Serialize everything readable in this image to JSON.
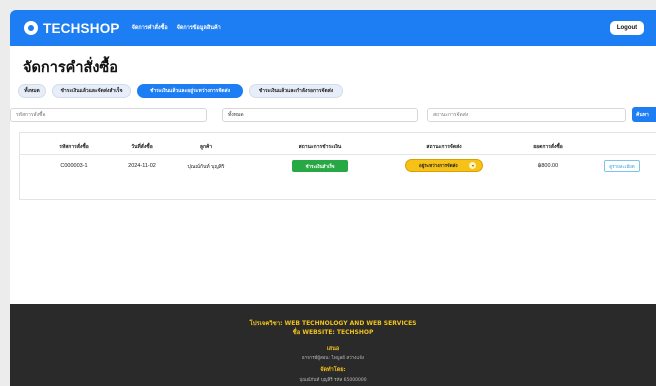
{
  "navbar": {
    "brand": "TECHSHOP",
    "links": [
      "จัดการคำสั่งซื้อ",
      "จัดการข้อมูลสินค้า"
    ],
    "logout_label": "Logout"
  },
  "main": {
    "title": "จัดการคำสั่งซื้อ",
    "filter_tabs": [
      {
        "label": "ทั้งหมด",
        "active": false
      },
      {
        "label": "ชำระเงินแล้วและจัดส่งสำเร็จ",
        "active": false
      },
      {
        "label": "ชำระเงินแล้วและอยู่ระหว่างการจัดส่ง",
        "active": true
      },
      {
        "label": "ชำระเงินแล้วและกำลังรอการจัดส่ง",
        "active": false
      }
    ],
    "search": {
      "order_id_placeholder": "รหัสการสั่งซื้อ",
      "payment_filter_value": "ทั้งหมด",
      "shipping_filter_placeholder": "สถานะการจัดส่ง",
      "search_button_label": "ค้นหา"
    }
  },
  "table": {
    "columns": [
      "รหัสการสั่งซื้อ",
      "วันที่สั่งซื้อ",
      "ลูกค้า",
      "สถานะการชำระเงิน",
      "สถานะการจัดส่ง",
      "ยอดการสั่งซื้อ"
    ],
    "rows": [
      {
        "order_id": "C000003-1",
        "order_date": "2024-11-02",
        "customer": "ปุณณ์กันท์ บุญสิริ",
        "payment_status": "ชำระเงินสำเร็จ",
        "shipping_status": "อยู่ระหว่างการจัดส่ง",
        "total": "฿800.00",
        "detail_label": "ดูรายละเอียด"
      }
    ]
  },
  "footer": {
    "project_line": "โปรเจควิชา: WEB TECHNOLOGY AND WEB SERVICES",
    "website_line": "ชื่อ WEBSITE: TECHSHOP",
    "advisor_label": "เสนอ",
    "advisor_name": "อาจารย์ผู้สอน: ไพบูลย์ สว่างแจ้ง",
    "team_label": "จัดทำโดย:",
    "team_first": "ปุณณ์กันท์ บุญสิริ รหัส 65000000"
  },
  "colors": {
    "primary": "#1d7df2",
    "paid_badge": "#27a845",
    "shipping_badge": "#f6c218",
    "footer_bg": "#2a2a2a",
    "footer_accent": "#f2c21a"
  }
}
